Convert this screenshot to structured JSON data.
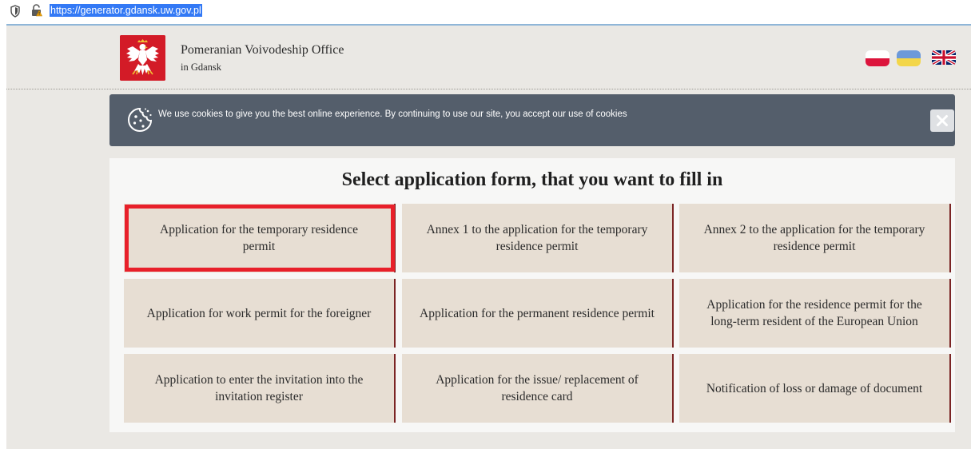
{
  "browser": {
    "url": "https://generator.gdansk.uw.gov.pl"
  },
  "header": {
    "title": "Pomeranian Voivodeship Office",
    "subtitle": "in Gdansk",
    "languages": [
      "pl-flag-icon",
      "ua-flag-icon",
      "uk-flag-icon"
    ]
  },
  "cookie_banner": {
    "text": "We use cookies to give you the best online experience. By continuing to use our site, you accept our use of cookies",
    "close_label": "close-icon"
  },
  "main": {
    "heading": "Select application form, that you want to fill in",
    "highlighted_form_index": 0,
    "forms": [
      {
        "label": "Application for the temporary residence permit"
      },
      {
        "label": "Annex 1 to the application for the temporary residence permit"
      },
      {
        "label": "Annex 2 to the application for the temporary residence permit"
      },
      {
        "label": "Application for work permit for the foreigner"
      },
      {
        "label": "Application for the permanent residence permit"
      },
      {
        "label": "Application for the residence permit for the long-term resident of the European Union"
      },
      {
        "label": "Application to enter the invitation into the invitation register"
      },
      {
        "label": "Application for the issue/ replacement of residence card"
      },
      {
        "label": "Notification of loss or damage of document"
      }
    ]
  },
  "colors": {
    "highlight": "#e8202a",
    "card_background": "#e7ded3",
    "cookie_banner": "#545e6b",
    "emblem": "#d31b27"
  }
}
